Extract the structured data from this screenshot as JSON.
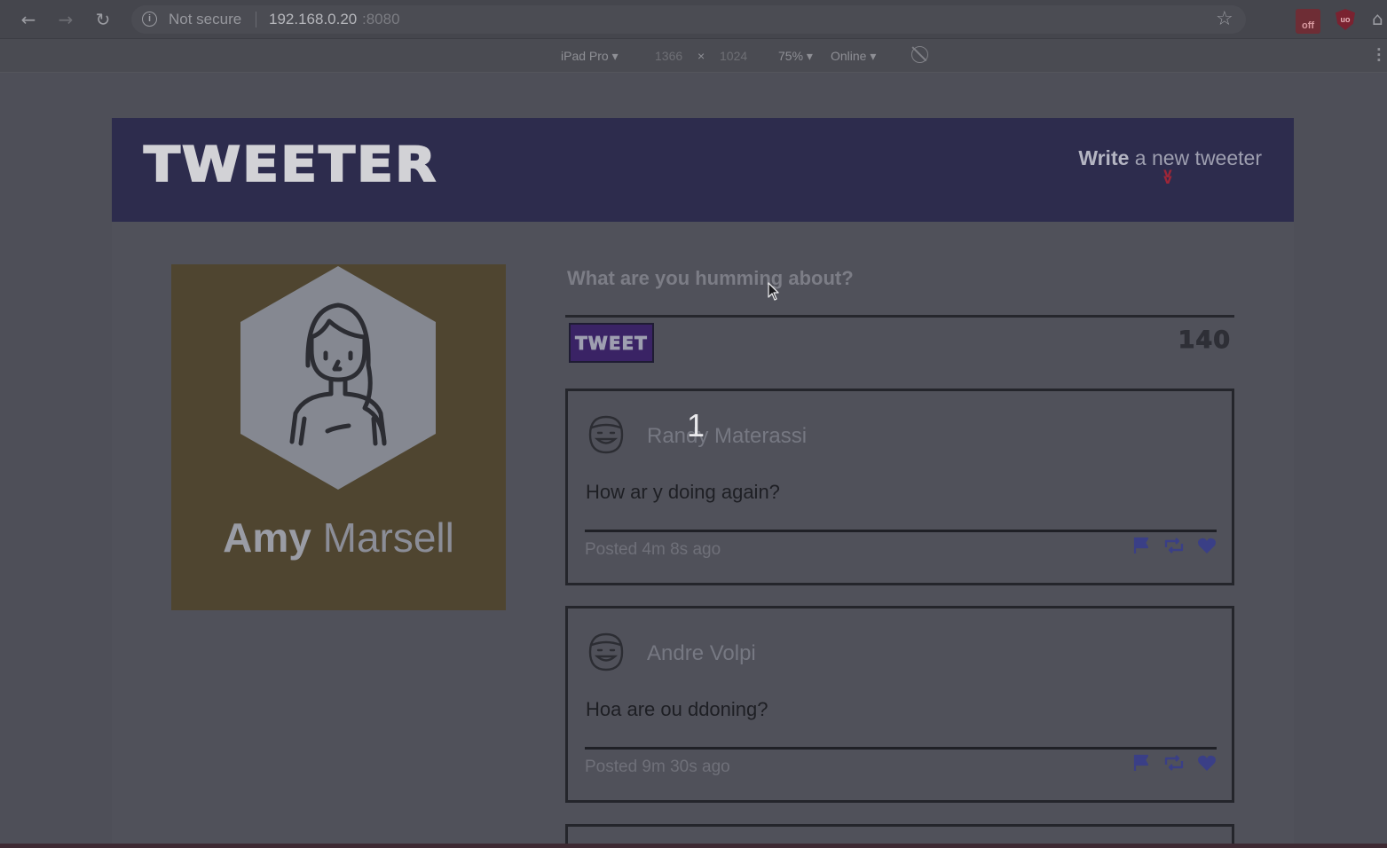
{
  "browser": {
    "security_label": "Not secure",
    "url_host": "192.168.0.20",
    "url_port": ":8080",
    "extension_badge": "off",
    "shield_label": "uo"
  },
  "device_toolbar": {
    "device": "iPad Pro",
    "width": "1366",
    "times": "×",
    "height": "1024",
    "zoom": "75%",
    "network": "Online"
  },
  "header": {
    "logo": "TWEETER",
    "write_bold": "Write",
    "write_rest": " a new tweeter"
  },
  "profile": {
    "first_name": "Amy",
    "last_name": " Marsell"
  },
  "compose": {
    "placeholder": "What are you humming about?",
    "button_label": "TWEET",
    "char_count": "140"
  },
  "tweets": [
    {
      "author": "Randy Materassi",
      "text": "How ar y doing again?",
      "posted": "Posted 4m 8s ago"
    },
    {
      "author": "Andre Volpi",
      "text": "Hoa are ou ddoning?",
      "posted": "Posted 9m 30s ago"
    }
  ],
  "overlay_number": "1",
  "colors": {
    "header_bg": "#2d2c4d",
    "profile_bg": "#4f4530",
    "tweet_button": "#3a2365",
    "action_icons": "#3a3f86"
  }
}
